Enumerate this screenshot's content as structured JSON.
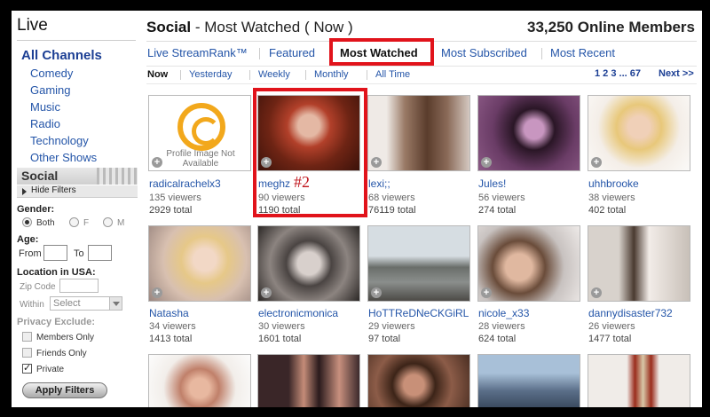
{
  "sidebar": {
    "title": "Live",
    "categories": [
      "All Channels",
      "Comedy",
      "Gaming",
      "Music",
      "Radio",
      "Technology",
      "Other Shows"
    ],
    "section_label": "Social",
    "hide_filters": "Hide Filters",
    "gender_label": "Gender:",
    "gender_options": [
      "Both",
      "F",
      "M"
    ],
    "gender_selected": "Both",
    "age_label": "Age:",
    "age_from": "From",
    "age_to": "To",
    "location_label": "Location in USA:",
    "zip_label": "Zip Code",
    "within_label": "Within",
    "within_value": "Select",
    "privacy_label": "Privacy Exclude:",
    "privacy": [
      {
        "label": "Members Only",
        "checked": false
      },
      {
        "label": "Friends Only",
        "checked": false
      },
      {
        "label": "Private",
        "checked": true
      }
    ],
    "apply_button": "Apply Filters"
  },
  "header": {
    "section": "Social",
    "subtitle": " - Most Watched ( Now )",
    "online": "33,250 Online Members"
  },
  "tabs": [
    "Live StreamRank™",
    "Featured",
    "Most Watched",
    "Most Subscribed",
    "Most Recent"
  ],
  "active_tab": "Most Watched",
  "filters": [
    "Now",
    "Yesterday",
    "Weekly",
    "Monthly",
    "All Time"
  ],
  "active_filter": "Now",
  "pagination": {
    "pages": "1 2 3 ... 67",
    "next": "Next >>"
  },
  "channels": [
    {
      "name": "radicalrachelx3",
      "viewers": "135 viewers",
      "total": "2929 total",
      "no_image": true,
      "no_image_text": "Profile Image Not Available"
    },
    {
      "name": "meghz",
      "viewers": "90 viewers",
      "total": "1190 total",
      "annotation": "#2"
    },
    {
      "name": "lexi;;",
      "viewers": "68 viewers",
      "total": "76119 total"
    },
    {
      "name": "Jules!",
      "viewers": "56 viewers",
      "total": "274 total"
    },
    {
      "name": "uhhbrooke",
      "viewers": "38 viewers",
      "total": "402 total"
    },
    {
      "name": "Natasha",
      "viewers": "34 viewers",
      "total": "1413 total"
    },
    {
      "name": "electronicmonica",
      "viewers": "30 viewers",
      "total": "1601 total"
    },
    {
      "name": "HoTTReDNeCKGiRL",
      "viewers": "29 viewers",
      "total": "97 total"
    },
    {
      "name": "nicole_x33",
      "viewers": "28 viewers",
      "total": "624 total"
    },
    {
      "name": "dannydisaster732",
      "viewers": "26 viewers",
      "total": "1477 total"
    }
  ],
  "colors": {
    "link": "#2455a8",
    "highlight": "#e1131b",
    "accent": "#f2a81c"
  }
}
